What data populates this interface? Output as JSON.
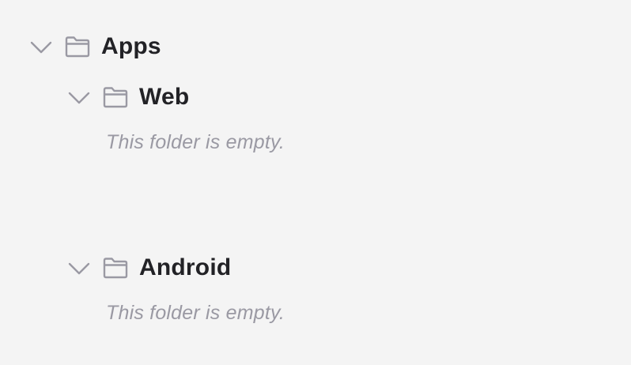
{
  "tree": {
    "root": {
      "name": "Apps",
      "expanded": true,
      "children": [
        {
          "name": "Web",
          "expanded": true,
          "empty_message": "This folder is empty."
        },
        {
          "name": "Android",
          "expanded": true,
          "empty_message": "This folder is empty."
        }
      ]
    }
  },
  "icons": {
    "chevron": "chevron-down-icon",
    "folder": "folder-icon"
  },
  "colors": {
    "background": "#f4f4f4",
    "folder_name": "#222226",
    "icon": "#9a99a3",
    "empty_text": "#9a99a3"
  }
}
